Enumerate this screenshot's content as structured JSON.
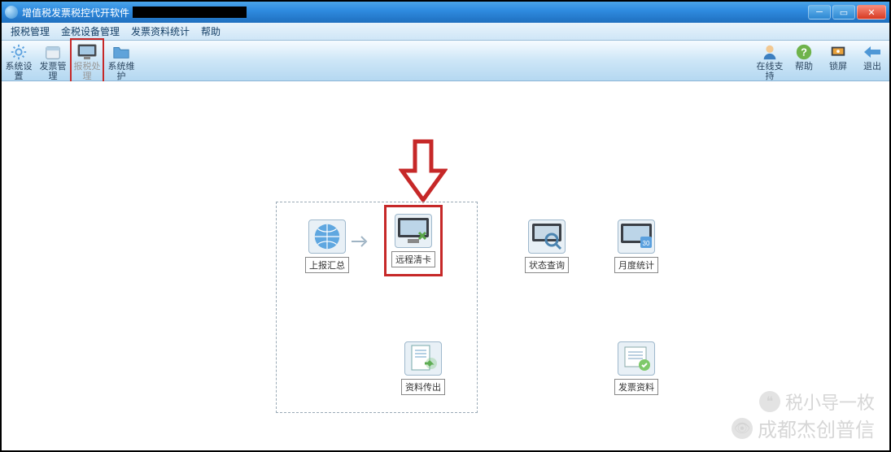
{
  "window": {
    "title": "增值税发票税控代开软件"
  },
  "menu": {
    "items": [
      "报税管理",
      "金税设备管理",
      "发票资料统计",
      "帮助"
    ]
  },
  "toolbar": {
    "left": [
      {
        "label": "系统设置",
        "icon": "gear"
      },
      {
        "label": "发票管理",
        "icon": "calendar"
      },
      {
        "label": "报税处理",
        "icon": "monitor",
        "highlight": true
      },
      {
        "label": "系统维护",
        "icon": "folder"
      }
    ],
    "right": [
      {
        "label": "在线支持",
        "icon": "user"
      },
      {
        "label": "帮助",
        "icon": "question"
      },
      {
        "label": "锁屏",
        "icon": "lock"
      },
      {
        "label": "退出",
        "icon": "back"
      }
    ]
  },
  "main": {
    "row1": [
      {
        "label": "上报汇总",
        "icon": "globe"
      },
      {
        "label": "远程清卡",
        "icon": "monitor-clear",
        "highlight": true
      },
      {
        "label": "状态查询",
        "icon": "search-monitor"
      },
      {
        "label": "月度统计",
        "icon": "monitor-date"
      }
    ],
    "row2": [
      {
        "label": "资料传出",
        "icon": "doc-export"
      },
      {
        "label": "发票资料",
        "icon": "doc-list"
      }
    ]
  },
  "watermark": {
    "line1": "税小导一枚",
    "line2": "成都杰创普信"
  }
}
